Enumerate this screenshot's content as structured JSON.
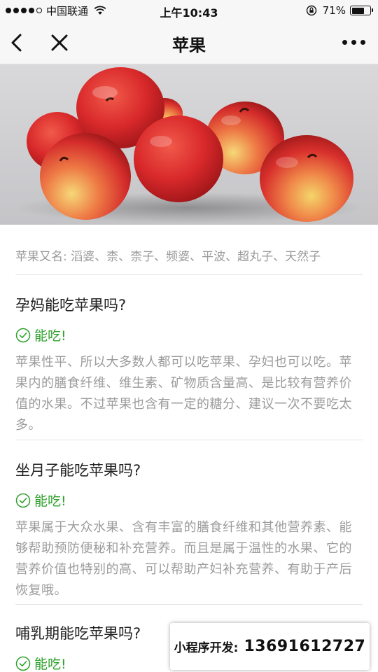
{
  "status_bar": {
    "carrier": "中国联通",
    "time": "上午10:43",
    "battery_percent": "71%",
    "battery_level": 0.71
  },
  "nav": {
    "title": "苹果",
    "back_icon": "chevron-left-icon",
    "close_icon": "close-icon",
    "more_icon": "more-dots-icon"
  },
  "hero": {
    "image": "red-apples-photo"
  },
  "alias": "苹果又名: 滔婆、柰、柰子、频婆、平波、超丸子、天然子",
  "qa": [
    {
      "question": "孕妈能吃苹果吗?",
      "answer": "能吃!",
      "detail": "苹果性平、所以大多数人都可以吃苹果、孕妇也可以吃。苹果内的膳食纤维、维生素、矿物质含量高、是比较有营养价值的水果。不过苹果也含有一定的糖分、建议一次不要吃太多。"
    },
    {
      "question": "坐月子能吃苹果吗?",
      "answer": "能吃!",
      "detail": "苹果属于大众水果、含有丰富的膳食纤维和其他营养素、能够帮助预防便秘和补充营养。而且是属于温性的水果、它的营养价值也特别的高、可以帮助产妇补充营养、有助于产后恢复哦。"
    },
    {
      "question": "哺乳期能吃苹果吗?",
      "answer": "能吃!"
    }
  ],
  "dev_badge": {
    "label": "小程序开发:",
    "phone": "13691612727"
  },
  "colors": {
    "answer_green": "#2ea12b",
    "muted_text": "#9b9b9b",
    "nav_bg": "#f7f7f7"
  }
}
